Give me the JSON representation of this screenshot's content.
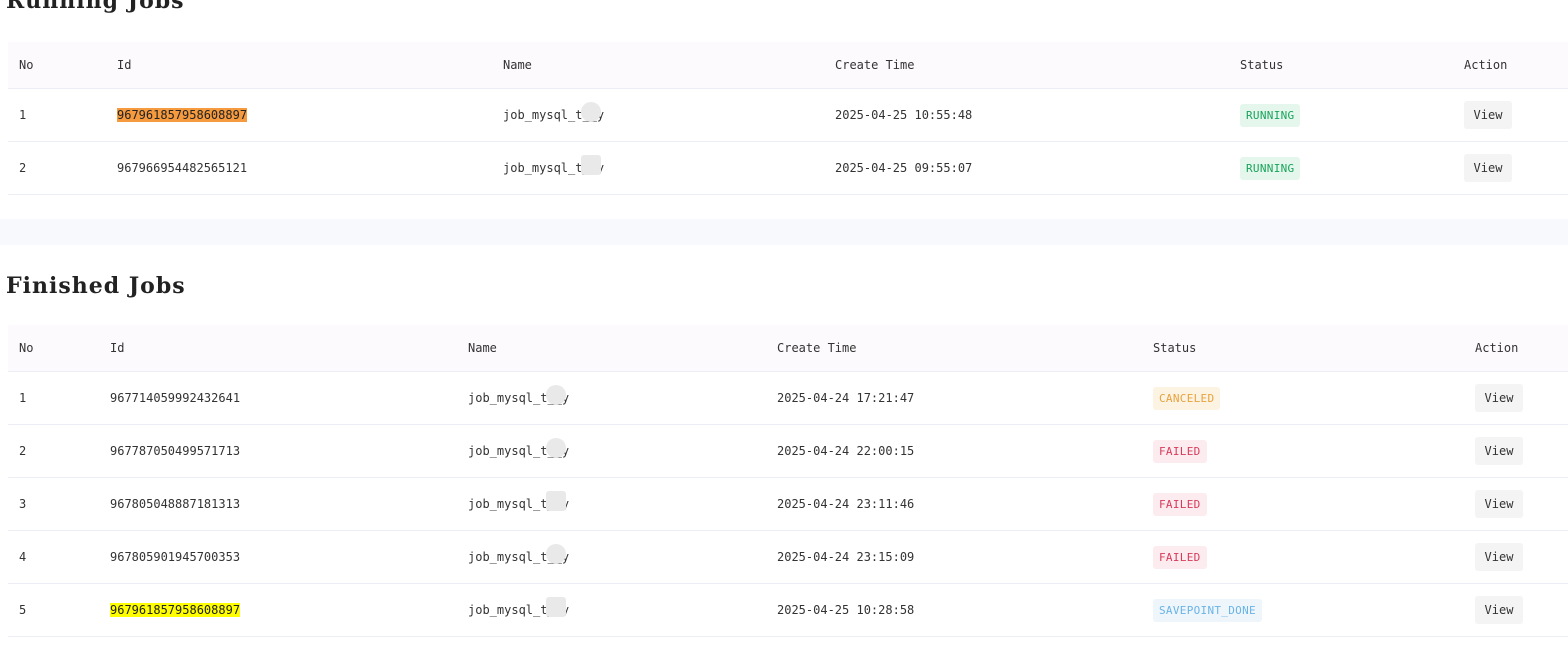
{
  "running": {
    "title": "Running Jobs",
    "columns": {
      "no": "No",
      "id": "Id",
      "name": "Name",
      "create_time": "Create Time",
      "status": "Status",
      "action": "Action"
    },
    "rows": [
      {
        "no": "1",
        "id": "967961857958608897",
        "name": "job_mysql_t__y",
        "create_time": "2025-04-25 10:55:48",
        "status": "RUNNING",
        "action": "View",
        "highlight": "#f59a3e"
      },
      {
        "no": "2",
        "id": "967966954482565121",
        "name": "job_mysql_t__y",
        "create_time": "2025-04-25 09:55:07",
        "status": "RUNNING",
        "action": "View"
      }
    ]
  },
  "finished": {
    "title": "Finished Jobs",
    "columns": {
      "no": "No",
      "id": "Id",
      "name": "Name",
      "create_time": "Create Time",
      "status": "Status",
      "action": "Action"
    },
    "rows": [
      {
        "no": "1",
        "id": "967714059992432641",
        "name": "job_mysql_t__y",
        "create_time": "2025-04-24 17:21:47",
        "status": "CANCELED",
        "action": "View"
      },
      {
        "no": "2",
        "id": "967787050499571713",
        "name": "job_mysql_t__y",
        "create_time": "2025-04-24 22:00:15",
        "status": "FAILED",
        "action": "View"
      },
      {
        "no": "3",
        "id": "967805048887181313",
        "name": "job_mysql_t__y",
        "create_time": "2025-04-24 23:11:46",
        "status": "FAILED",
        "action": "View"
      },
      {
        "no": "4",
        "id": "967805901945700353",
        "name": "job_mysql_t__y",
        "create_time": "2025-04-24 23:15:09",
        "status": "FAILED",
        "action": "View"
      },
      {
        "no": "5",
        "id": "967961857958608897",
        "name": "job_mysql_t__y",
        "create_time": "2025-04-25 10:28:58",
        "status": "SAVEPOINT_DONE",
        "action": "View",
        "highlight": "#ffff00"
      }
    ]
  },
  "status_colors": {
    "RUNNING": "#17a35a",
    "CANCELED": "#e6a23c",
    "FAILED": "#d73a5a",
    "SAVEPOINT_DONE": "#6ab3e6"
  }
}
